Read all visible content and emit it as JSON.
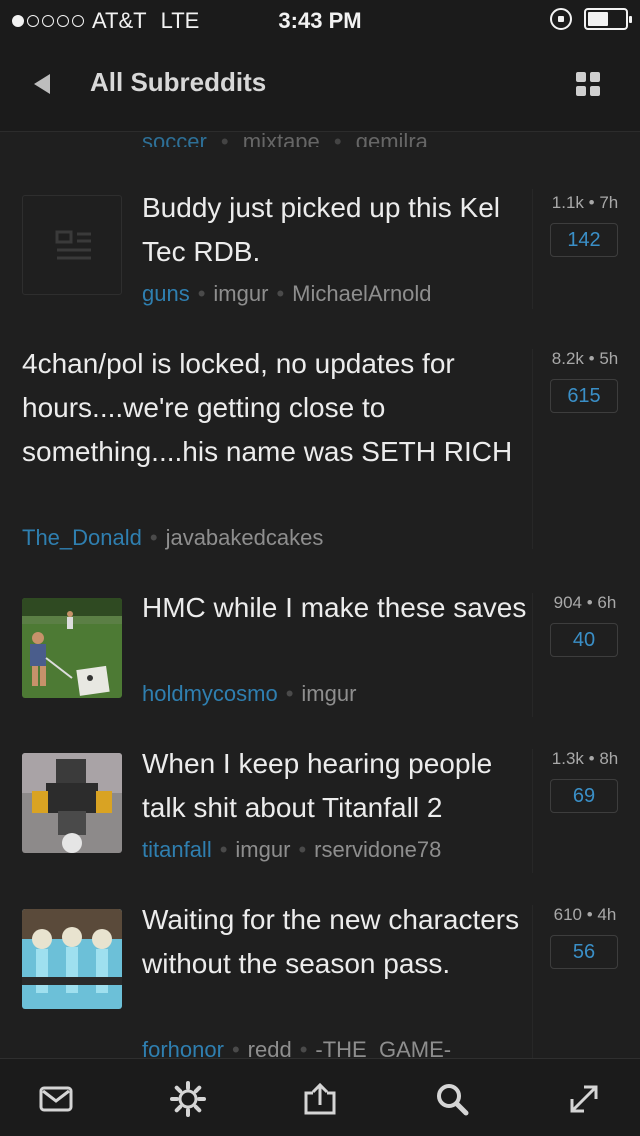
{
  "status_bar": {
    "carrier": "AT&T",
    "network": "LTE",
    "time": "3:43 PM",
    "signal_dots_filled": 1,
    "signal_dots_total": 5,
    "battery_level": 0.55
  },
  "navbar": {
    "title": "All Subreddits",
    "back_icon": "chevron-left-icon",
    "menu_icon": "grid-icon"
  },
  "partial_row": {
    "subreddit": "soccer",
    "domain": "mixtape",
    "author": "gemilra"
  },
  "posts": [
    {
      "title": "Buddy just picked up this Kel Tec RDB.",
      "subreddit": "guns",
      "domain": "imgur",
      "author": "MichaelArnold",
      "score": "1.1k",
      "age": "7h",
      "comments": "142",
      "thumbnail": "article-placeholder"
    },
    {
      "title": "4chan/pol is locked, no updates for hours....we're getting close to something....his name was SETH RICH",
      "subreddit": "The_Donald",
      "domain": "",
      "author": "javabakedcakes",
      "score": "8.2k",
      "age": "5h",
      "comments": "615",
      "thumbnail": ""
    },
    {
      "title": "HMC while I make these saves",
      "subreddit": "holdmycosmo",
      "domain": "imgur",
      "author": "",
      "score": "904",
      "age": "6h",
      "comments": "40",
      "thumbnail": "lawn-game-photo"
    },
    {
      "title": "When I keep hearing people talk shit about Titanfall 2",
      "subreddit": "titanfall",
      "domain": "imgur",
      "author": "rservidone78",
      "score": "1.3k",
      "age": "8h",
      "comments": "69",
      "thumbnail": "robot-figure-photo"
    },
    {
      "title": "Waiting for the new characters without the season pass.",
      "subreddit": "forhonor",
      "domain": "redd",
      "author": "-THE_GAME-",
      "score": "610",
      "age": "4h",
      "comments": "56",
      "thumbnail": "skeleton-meme-image"
    }
  ],
  "toolbar": {
    "items": [
      "mail-icon",
      "settings-icon",
      "share-icon",
      "search-icon",
      "expand-icon"
    ]
  },
  "colors": {
    "background": "#1f1f1f",
    "accent_blue": "#2f7fb0",
    "comment_blue": "#3a8fc7"
  }
}
